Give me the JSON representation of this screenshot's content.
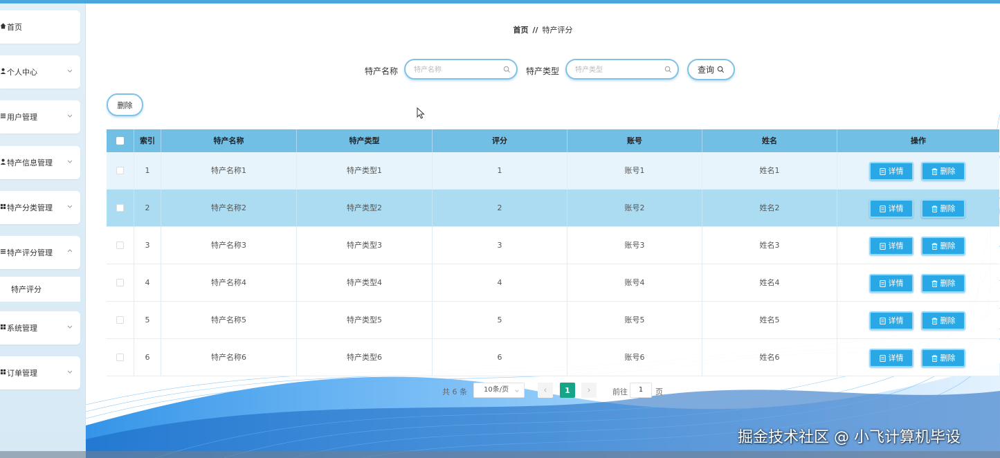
{
  "sidebar": {
    "items": [
      {
        "label": "首页",
        "icon": "home-icon",
        "has_children": false
      },
      {
        "label": "个人中心",
        "icon": "user-icon",
        "has_children": true
      },
      {
        "label": "用户管理",
        "icon": "menu-icon",
        "has_children": true
      },
      {
        "label": "特产信息管理",
        "icon": "user-icon",
        "has_children": true
      },
      {
        "label": "特产分类管理",
        "icon": "grid-icon",
        "has_children": true
      },
      {
        "label": "特产评分管理",
        "icon": "menu-icon",
        "has_children": true
      },
      {
        "label": "系统管理",
        "icon": "grid-icon",
        "has_children": true
      },
      {
        "label": "订单管理",
        "icon": "grid-icon",
        "has_children": true
      }
    ],
    "submenu_label": "特产评分"
  },
  "breadcrumb": {
    "home": "首页",
    "separator": "//",
    "current": "特产评分"
  },
  "search": {
    "name_label": "特产名称",
    "name_placeholder": "特产名称",
    "type_label": "特产类型",
    "type_placeholder": "特产类型",
    "query_label": "查询"
  },
  "toolbar": {
    "delete_label": "删除"
  },
  "table": {
    "headers": [
      "索引",
      "特产名称",
      "特产类型",
      "评分",
      "账号",
      "姓名",
      "操作"
    ],
    "rows": [
      {
        "index": "1",
        "name": "特产名称1",
        "type": "特产类型1",
        "score": "1",
        "account": "账号1",
        "person": "姓名1"
      },
      {
        "index": "2",
        "name": "特产名称2",
        "type": "特产类型2",
        "score": "2",
        "account": "账号2",
        "person": "姓名2"
      },
      {
        "index": "3",
        "name": "特产名称3",
        "type": "特产类型3",
        "score": "3",
        "account": "账号3",
        "person": "姓名3"
      },
      {
        "index": "4",
        "name": "特产名称4",
        "type": "特产类型4",
        "score": "4",
        "account": "账号4",
        "person": "姓名4"
      },
      {
        "index": "5",
        "name": "特产名称5",
        "type": "特产类型5",
        "score": "5",
        "account": "账号5",
        "person": "姓名5"
      },
      {
        "index": "6",
        "name": "特产名称6",
        "type": "特产类型6",
        "score": "6",
        "account": "账号6",
        "person": "姓名6"
      }
    ],
    "detail_label": "详情",
    "delete_label": "删除"
  },
  "pagination": {
    "total": "共 6 条",
    "page_size": "10条/页",
    "current_page": "1",
    "goto_label": "前往",
    "goto_value": "1",
    "page_suffix": "页"
  },
  "watermark": "掘金技术社区 @ 小飞计算机毕设",
  "colors": {
    "accent": "#2aa8e6",
    "header": "#72bfe6",
    "selected_row": "#acdcf1",
    "pager_active": "#17a589"
  }
}
